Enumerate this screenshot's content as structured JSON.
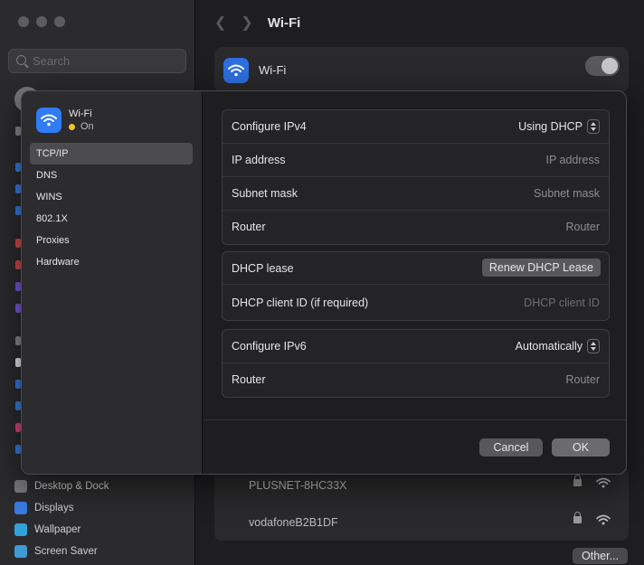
{
  "background": {
    "search_placeholder": "Search",
    "title": "Wi-Fi",
    "wifi_label": "Wi-Fi",
    "sidebar_items": [
      {
        "label": "Desktop & Dock",
        "icon": "desktop-dock-icon",
        "color": "#7a7a7e"
      },
      {
        "label": "Displays",
        "icon": "displays-icon",
        "color": "#3a7be0"
      },
      {
        "label": "Wallpaper",
        "icon": "wallpaper-icon",
        "color": "#33a1d8"
      },
      {
        "label": "Screen Saver",
        "icon": "screen-saver-icon",
        "color": "#3d9ad6"
      }
    ],
    "networks": [
      {
        "name": "PLUSNET-8HC33X"
      },
      {
        "name": "vodafoneB2B1DF"
      }
    ],
    "other_button": "Other..."
  },
  "sheet": {
    "network_name": "Wi-Fi",
    "status": "On",
    "status_color": "#f0c629",
    "nav": [
      {
        "label": "TCP/IP",
        "active": true
      },
      {
        "label": "DNS"
      },
      {
        "label": "WINS"
      },
      {
        "label": "802.1X"
      },
      {
        "label": "Proxies"
      },
      {
        "label": "Hardware"
      }
    ],
    "ipv4": {
      "configure_label": "Configure IPv4",
      "configure_value": "Using DHCP",
      "ip_label": "IP address",
      "ip_value": "IP address",
      "subnet_label": "Subnet mask",
      "subnet_value": "Subnet mask",
      "router_label": "Router",
      "router_value": "Router"
    },
    "dhcp": {
      "lease_label": "DHCP lease",
      "renew_button": "Renew DHCP Lease",
      "client_id_label": "DHCP client ID (if required)",
      "client_id_placeholder": "DHCP client ID"
    },
    "ipv6": {
      "configure_label": "Configure IPv6",
      "configure_value": "Automatically",
      "router_label": "Router",
      "router_value": "Router"
    },
    "cancel_button": "Cancel",
    "ok_button": "OK"
  }
}
